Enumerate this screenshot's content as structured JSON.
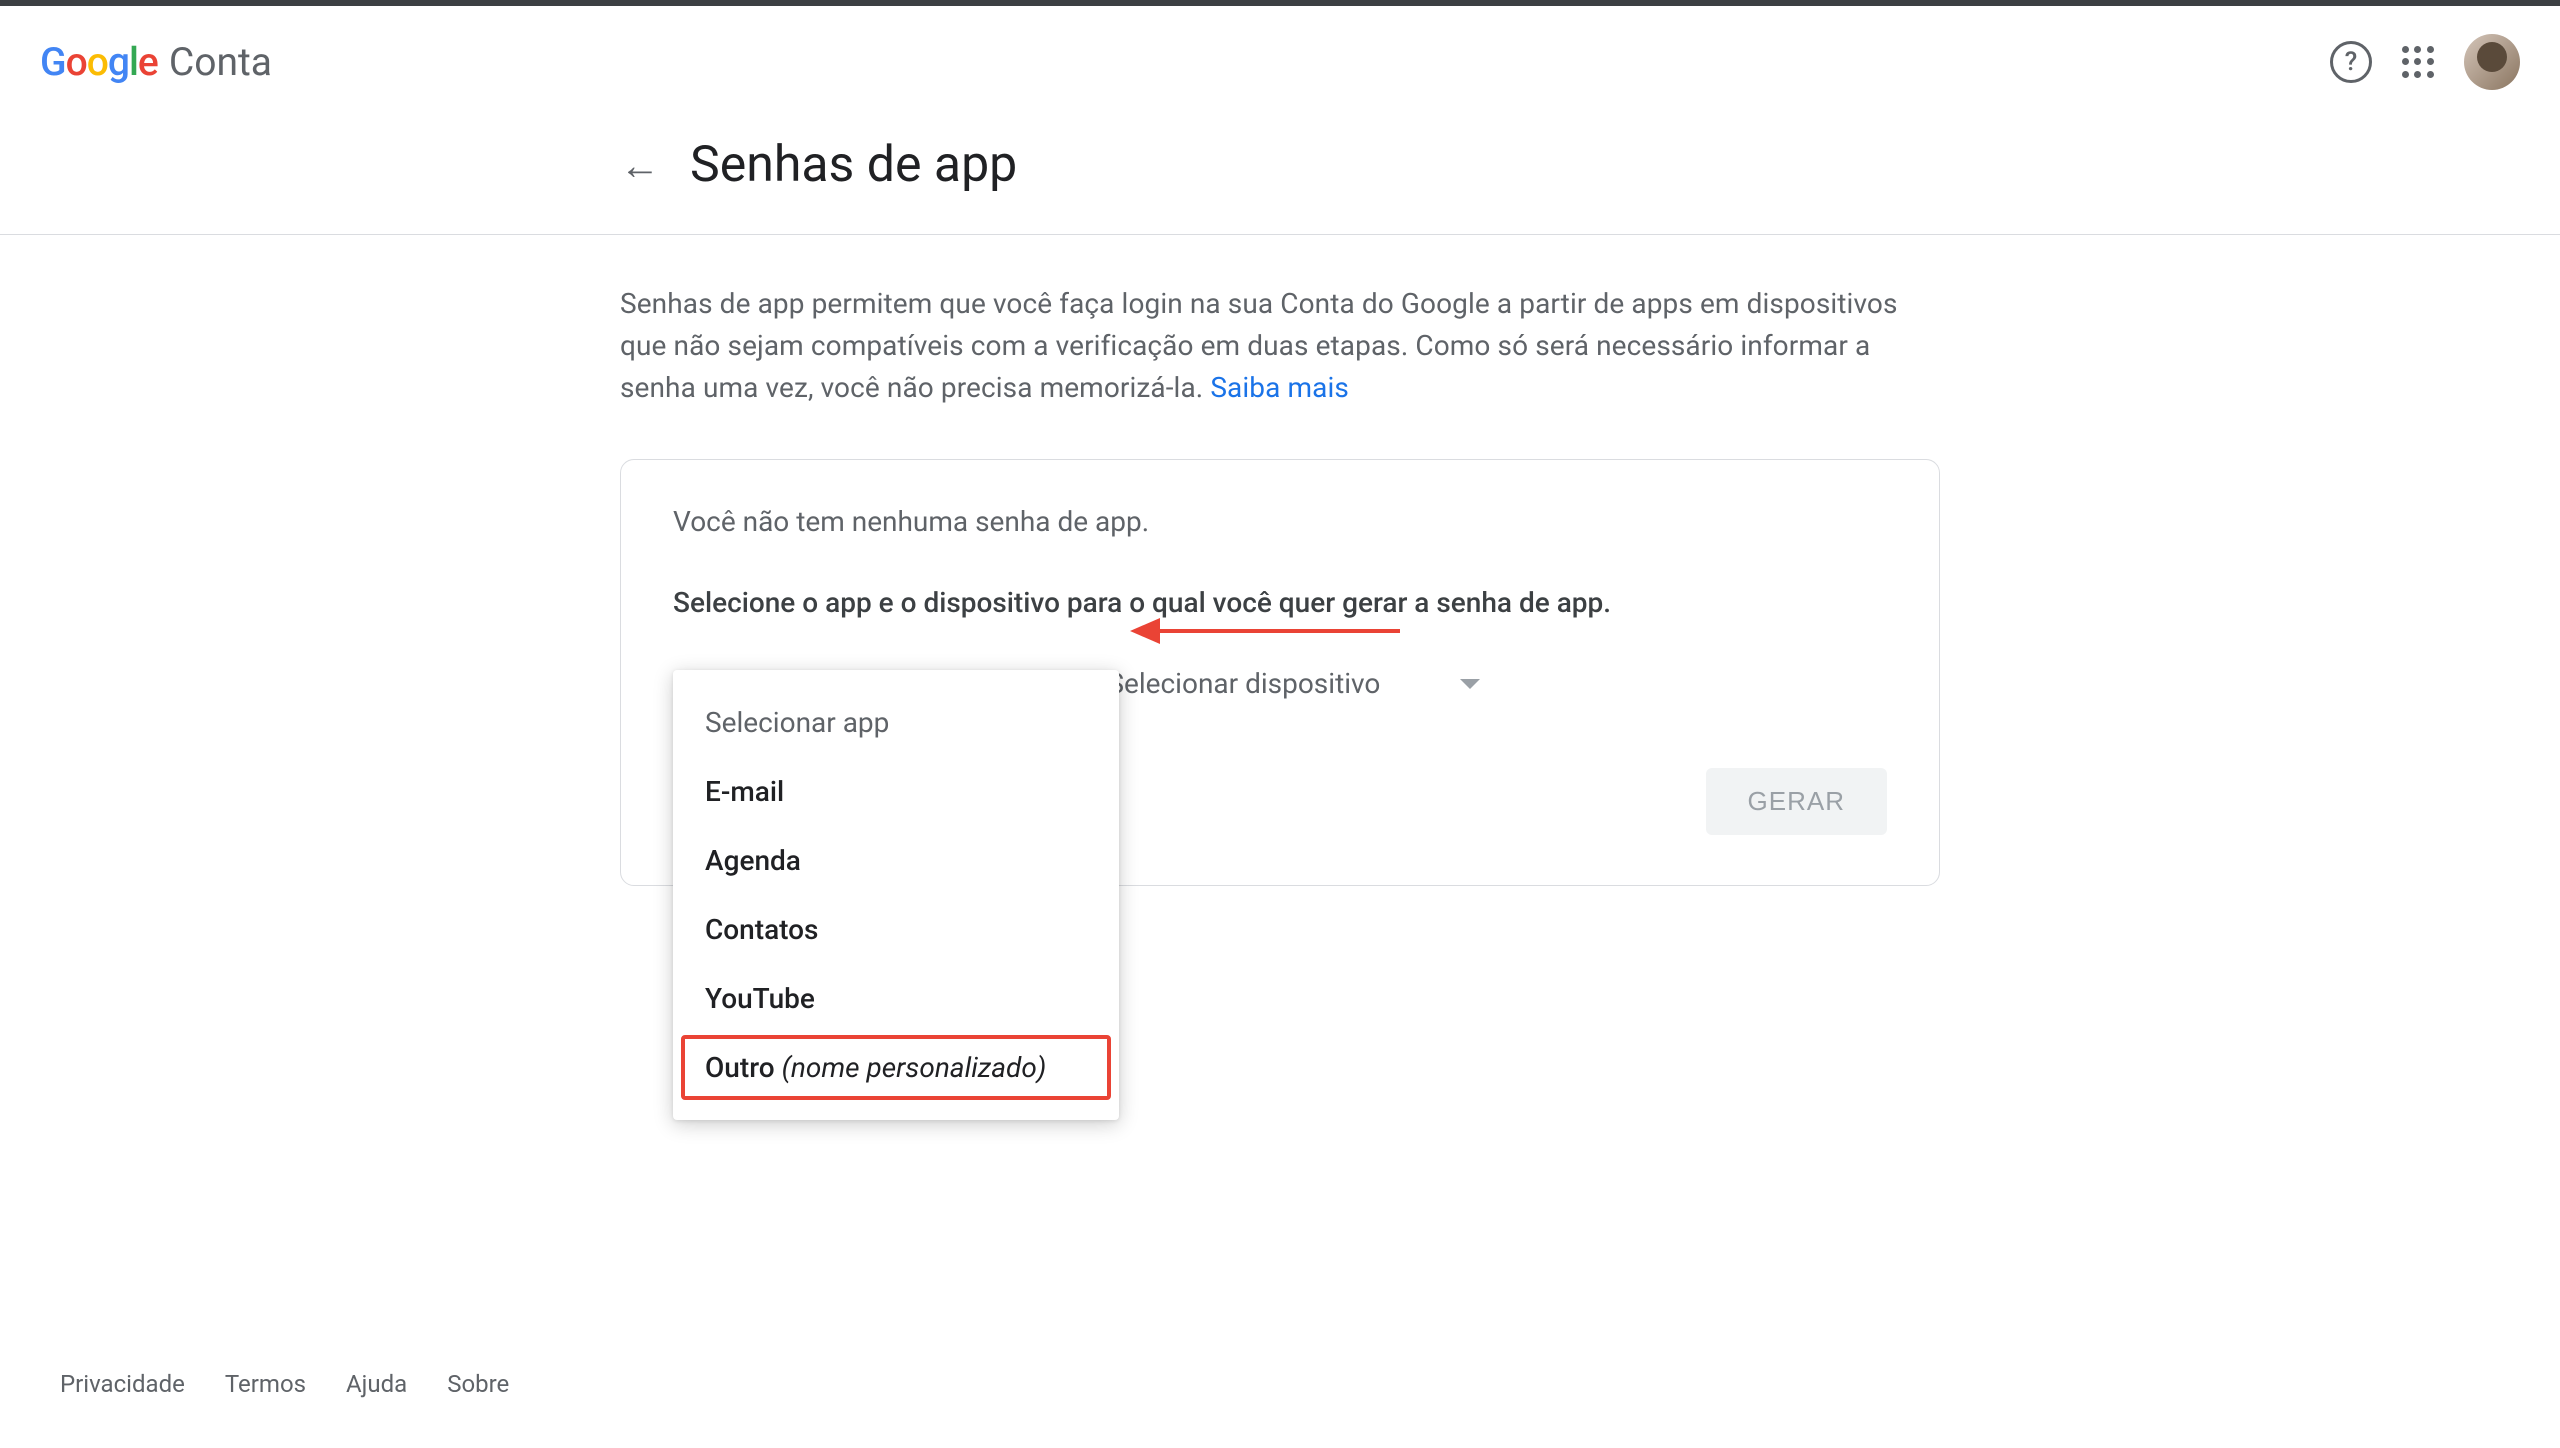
{
  "header": {
    "logo_text": "Google",
    "account_label": "Conta"
  },
  "page": {
    "title": "Senhas de app",
    "description": "Senhas de app permitem que você faça login na sua Conta do Google a partir de apps em dispositivos que não sejam compatíveis com a verificação em duas etapas. Como só será necessário informar a senha uma vez, você não precisa memorizá-la. ",
    "learn_more": "Saiba mais"
  },
  "card": {
    "no_passwords": "Você não tem nenhuma senha de app.",
    "instruction": "Selecione o app e o dispositivo para o qual você quer gerar a senha de app.",
    "select_app_label": "Selecionar app",
    "select_device_label": "Selecionar dispositivo",
    "generate_button": "GERAR"
  },
  "dropdown": {
    "header": "Selecionar app",
    "options": {
      "email": "E-mail",
      "calendar": "Agenda",
      "contacts": "Contatos",
      "youtube": "YouTube",
      "other_label": "Outro ",
      "other_hint": "(nome personalizado)"
    }
  },
  "footer": {
    "privacy": "Privacidade",
    "terms": "Termos",
    "help": "Ajuda",
    "about": "Sobre"
  }
}
